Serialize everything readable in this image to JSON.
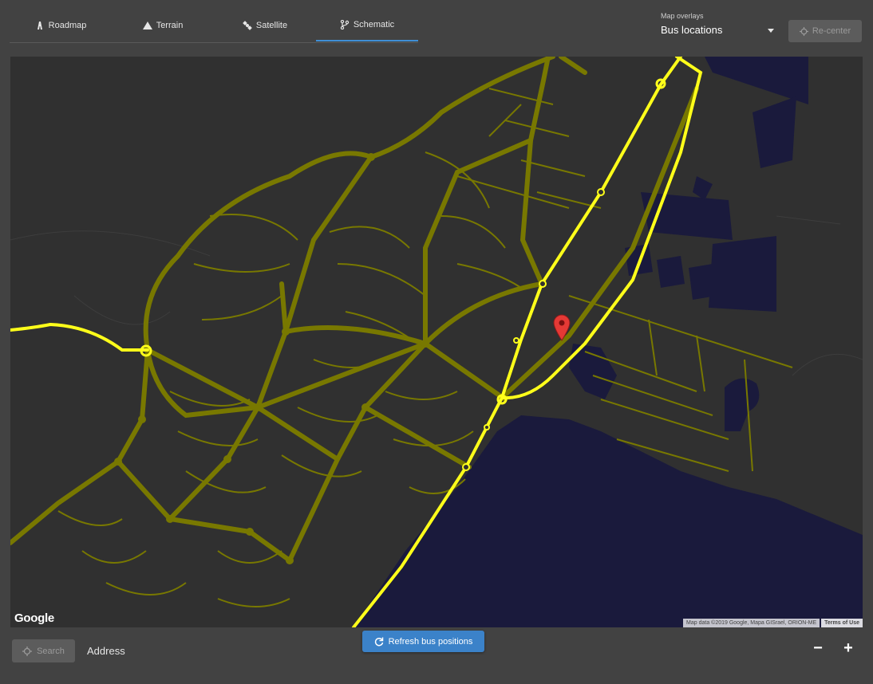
{
  "tabs": [
    {
      "label": "Roadmap",
      "icon": "road-icon",
      "active": false
    },
    {
      "label": "Terrain",
      "icon": "mountain-icon",
      "active": false
    },
    {
      "label": "Satellite",
      "icon": "satellite-icon",
      "active": false
    },
    {
      "label": "Schematic",
      "icon": "schematic-icon",
      "active": true
    }
  ],
  "overlays": {
    "label": "Map overlays",
    "value": "Bus locations",
    "icon": "caret-down-icon"
  },
  "recenter": {
    "label": "Re-center",
    "icon": "crosshair-icon",
    "disabled": true
  },
  "map": {
    "logo": "Google",
    "attribution": "Map data ©2019 Google, Mapa GISrael, ORION-ME",
    "terms": "Terms of Use",
    "marker": "map-pin-icon"
  },
  "search": {
    "label": "Search",
    "icon": "crosshair-icon",
    "disabled": true
  },
  "address": {
    "label": "Address"
  },
  "refresh": {
    "label": "Refresh bus positions",
    "icon": "refresh-icon"
  },
  "zoom": {
    "out": "−",
    "in": "+"
  },
  "colors": {
    "accent": "#3b82c9",
    "highway": "#ffff1a",
    "road": "#787800",
    "water": "#1a1a3c",
    "land": "#303030"
  }
}
